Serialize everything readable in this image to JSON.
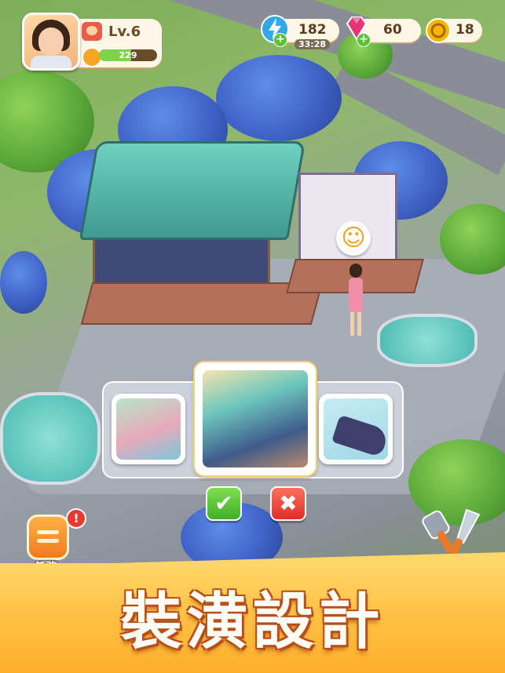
{
  "player": {
    "level_label": "Lv.6",
    "xp_value": "229",
    "xp_progress": 0.55
  },
  "resources": {
    "energy": {
      "value": "182",
      "timer": "33:28",
      "icon": "lightning-icon"
    },
    "gems": {
      "value": "60",
      "icon": "gem-icon"
    },
    "coins": {
      "value": "18",
      "icon": "coin-icon"
    }
  },
  "design_selector": {
    "options": [
      {
        "name": "koi-pond-design",
        "selected": false
      },
      {
        "name": "teahouse-design",
        "selected": true
      },
      {
        "name": "boat-design",
        "selected": false
      }
    ],
    "confirm_icon": "check-icon",
    "cancel_icon": "close-icon"
  },
  "quest_button": {
    "label": "任務",
    "alert": "!"
  },
  "banner": {
    "title": "裝潢設計"
  },
  "colors": {
    "banner": "#ffc246",
    "confirm": "#4fc02f",
    "cancel": "#e63a2e",
    "accent_text": "#5a3b22"
  }
}
